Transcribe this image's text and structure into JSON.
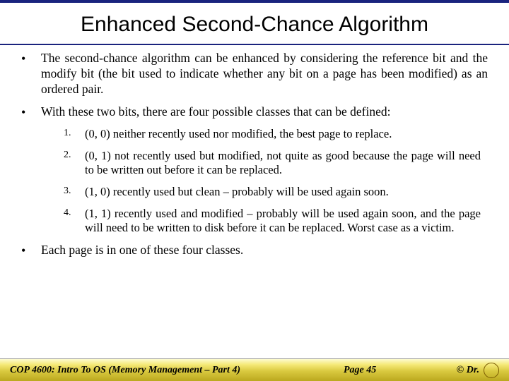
{
  "title": "Enhanced Second-Chance Algorithm",
  "bullets": {
    "b1": "The second-chance algorithm can be enhanced by considering the reference bit and the modify bit (the bit used to indicate whether any bit on a page has been modified) as an ordered pair.",
    "b2": "With these two bits, there are four possible classes that can be defined:",
    "b3": "Each page is in one of these four classes."
  },
  "classes": {
    "c1": "(0, 0) neither recently used nor modified, the best page to replace.",
    "c2": "(0, 1) not recently used but modified, not quite as good because the page will need to be written out before it can be replaced.",
    "c3": "(1, 0) recently used but clean – probably will be used again soon.",
    "c4": "(1, 1) recently used and modified – probably will be used again soon, and the page will need to be written to disk before it can be replaced.  Worst case as a victim."
  },
  "nums": {
    "n1": "1.",
    "n2": "2.",
    "n3": "3.",
    "n4": "4."
  },
  "footer": {
    "course": "COP 4600: Intro To OS  (Memory Management – Part 4)",
    "page": "Page 45",
    "credit": "© Dr."
  }
}
